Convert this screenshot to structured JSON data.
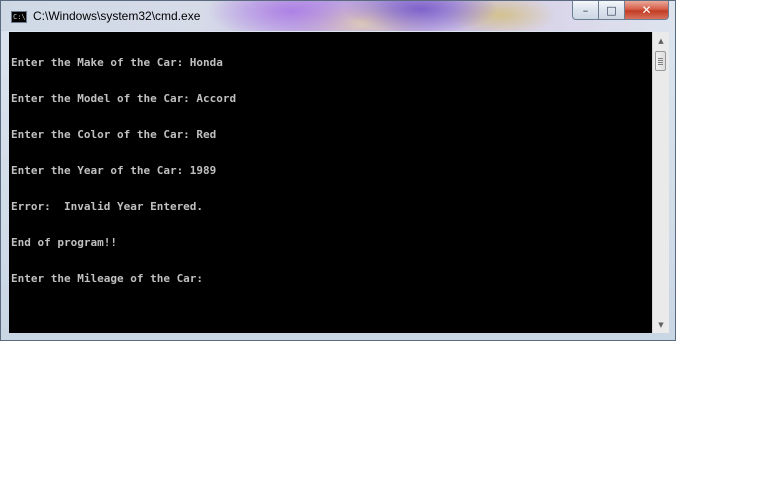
{
  "window": {
    "title": "C:\\Windows\\system32\\cmd.exe",
    "icon_name": "cmd-app-icon",
    "icon_glyph": "C:\\",
    "controls": {
      "minimize": "–",
      "maximize": "□",
      "close": "✕"
    }
  },
  "console": {
    "lines": [
      "Enter the Make of the Car: Honda",
      "Enter the Model of the Car: Accord",
      "Enter the Color of the Car: Red",
      "Enter the Year of the Car: 1989",
      "Error:  Invalid Year Entered.",
      "End of program!!",
      "Enter the Mileage of the Car:"
    ],
    "background": "#000000",
    "text_color": "#c0c0c0"
  },
  "scrollbar": {
    "up_arrow": "▲",
    "down_arrow": "▼"
  }
}
